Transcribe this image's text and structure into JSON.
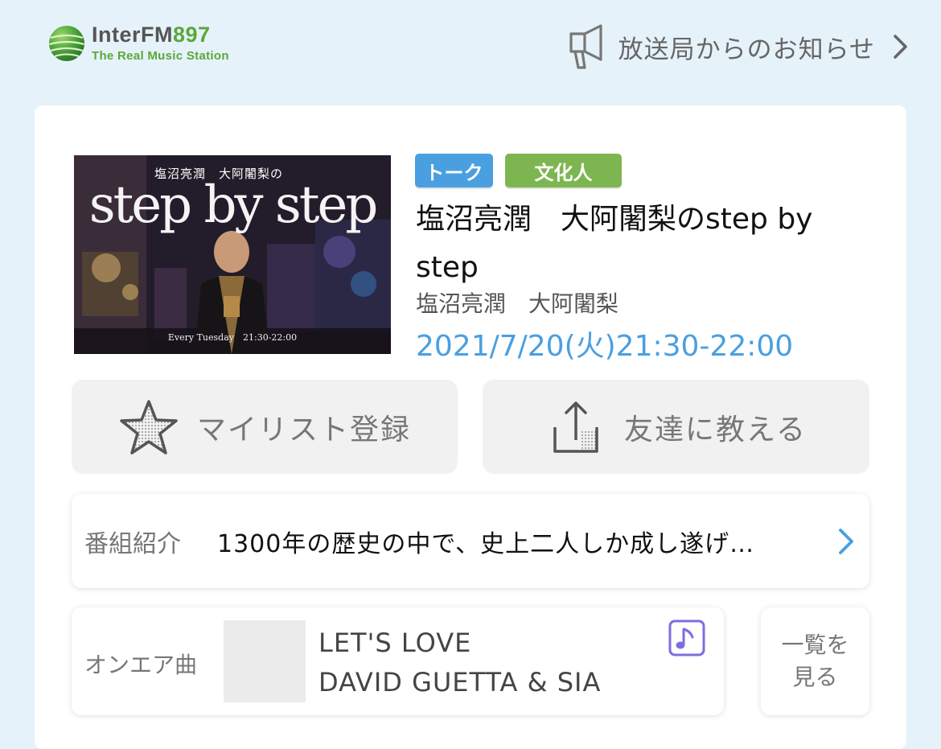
{
  "header": {
    "logo": {
      "main_prefix": "InterFM",
      "main_number": "897",
      "tagline": "The Real Music Station"
    },
    "notice_label": "放送局からのお知らせ"
  },
  "program": {
    "thumbnail": {
      "title_art": "step by step",
      "names_art": "塩沼亮潤　大阿闍梨の",
      "schedule_art": "Every Tuesday　21:30-22:00"
    },
    "tags": [
      "トーク",
      "文化人"
    ],
    "title": "塩沼亮潤　大阿闍梨のstep by step",
    "hosts": "塩沼亮潤　大阿闍梨",
    "datetime": "2021/7/20(火)21:30-22:00"
  },
  "actions": {
    "mylist_label": "マイリスト登録",
    "share_label": "友達に教える"
  },
  "intro": {
    "label": "番組紹介",
    "text": "1300年の歴史の中で、史上二人しか成し遂げ…"
  },
  "onair": {
    "label": "オンエア曲",
    "song": "LET'S LOVE",
    "artist": "DAVID GUETTA & SIA",
    "list_button_label": "一覧を見る"
  },
  "colors": {
    "background": "#e6f2f9",
    "accent_blue": "#4a9fe0",
    "accent_green": "#7db650",
    "logo_green": "#5aa83c",
    "music_icon": "#7b6fe0"
  },
  "icons": {
    "logo": "globe-logo-icon",
    "notice": "megaphone-icon",
    "chevron": "chevron-right-icon",
    "mylist": "star-icon",
    "share": "share-upload-icon",
    "music": "music-note-icon"
  }
}
